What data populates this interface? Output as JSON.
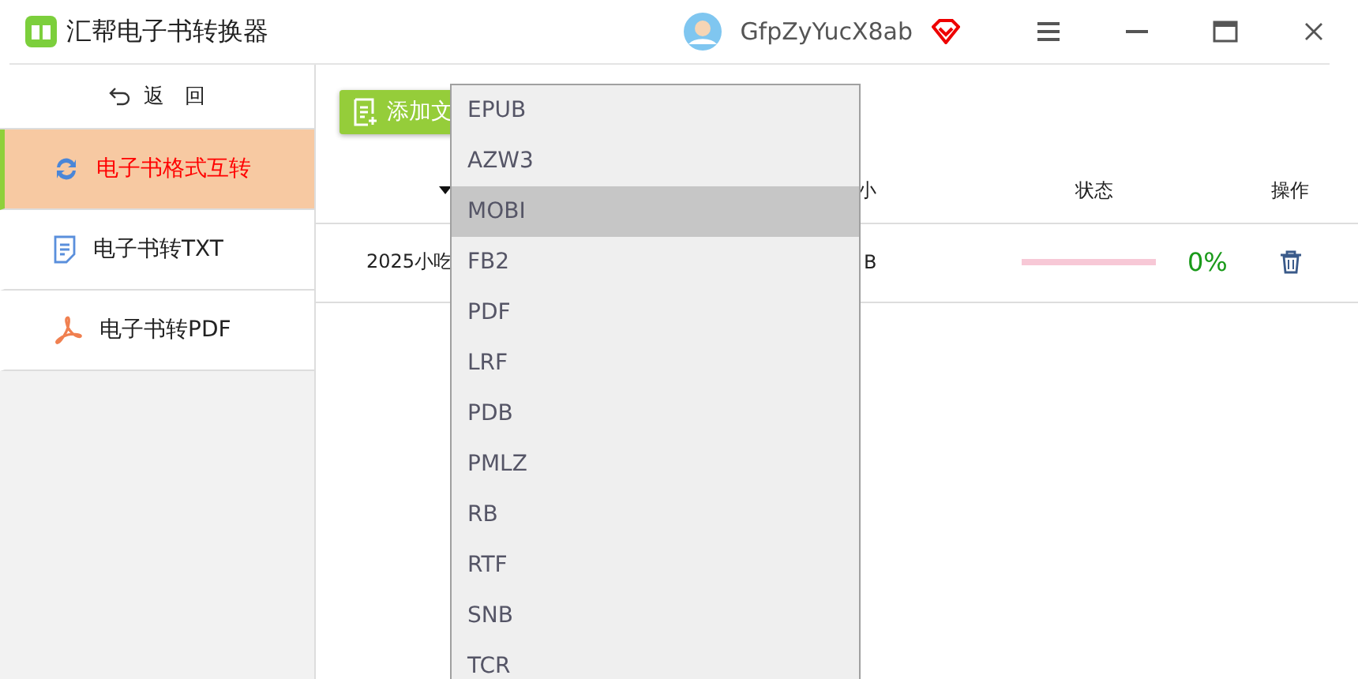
{
  "window": {
    "title": "汇帮电子书转换器",
    "user": "GfpZyYucX8ab"
  },
  "sidebar": {
    "back": "返　回",
    "items": [
      {
        "label": "电子书格式互转",
        "kind": "convert",
        "selected": true
      },
      {
        "label": "电子书转TXT",
        "kind": "txt",
        "selected": false
      },
      {
        "label": "电子书转PDF",
        "kind": "pdf",
        "selected": false
      }
    ]
  },
  "toolbar": {
    "add_button": "添加文"
  },
  "table": {
    "columns": [
      "小",
      "状态",
      "操作"
    ],
    "rows": [
      {
        "name": "2025小吃",
        "size": "B",
        "level": 0,
        "progress": "0%"
      }
    ]
  },
  "dropdown": {
    "options": [
      {
        "label": "EPUB",
        "selected": false
      },
      {
        "label": "AZW3",
        "selected": false
      },
      {
        "label": "MOBI",
        "selected": true
      },
      {
        "label": "FB2",
        "selected": false
      },
      {
        "label": "PDF",
        "selected": false
      },
      {
        "label": "LRF",
        "selected": false
      },
      {
        "label": "PDB",
        "selected": false
      },
      {
        "label": "PMLZ",
        "selected": false
      },
      {
        "label": "RB",
        "selected": false
      },
      {
        "label": "RTF",
        "selected": false
      },
      {
        "label": "SNB",
        "selected": false
      },
      {
        "label": "TCR",
        "selected": false
      }
    ]
  }
}
